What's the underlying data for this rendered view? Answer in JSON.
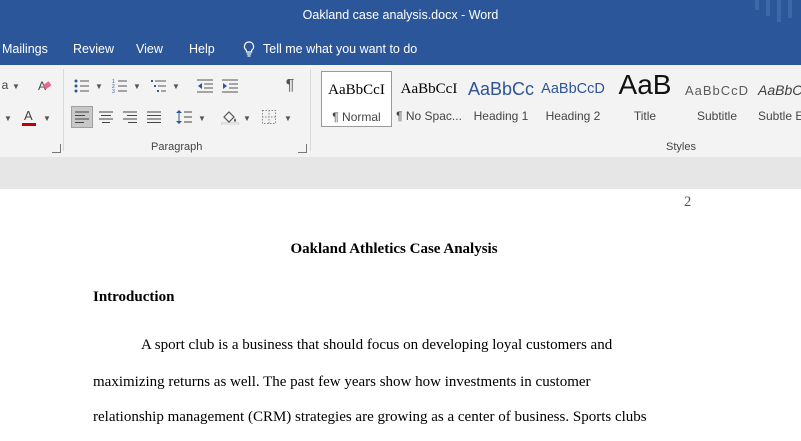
{
  "window": {
    "title": "Oakland case analysis.docx  -  Word"
  },
  "tabs": [
    "Mailings",
    "Review",
    "View",
    "Help"
  ],
  "tell_me": "Tell me what you want to do",
  "ribbon": {
    "font_partial": "a",
    "paragraph_label": "Paragraph",
    "styles_label": "Styles",
    "styles": [
      {
        "sample": "AaBbCcI",
        "name": "¶ Normal"
      },
      {
        "sample": "AaBbCcI",
        "name": "¶ No Spac..."
      },
      {
        "sample": "AaBbCc",
        "name": "Heading 1"
      },
      {
        "sample": "AaBbCcD",
        "name": "Heading 2"
      },
      {
        "sample": "AaB",
        "name": "Title"
      },
      {
        "sample": "AaBbCcD",
        "name": "Subtitle"
      },
      {
        "sample": "AaBbCc",
        "name": "Subtle E"
      }
    ]
  },
  "document": {
    "page_number": "2",
    "title": "Oakland Athletics Case Analysis",
    "heading": "Introduction",
    "lines": [
      "A sport club is a business that should focus on developing loyal customers and",
      "maximizing returns as well. The past few years show how investments in customer",
      "relationship management (CRM) strategies are growing as a center of business. Sports clubs"
    ]
  },
  "colors": {
    "title_bar": "#2b579a",
    "ribbon": "#f3f3f3",
    "font_color_swatch": "#c00000",
    "canvas": "#e6e6e6",
    "heading1": "#2f5496"
  }
}
